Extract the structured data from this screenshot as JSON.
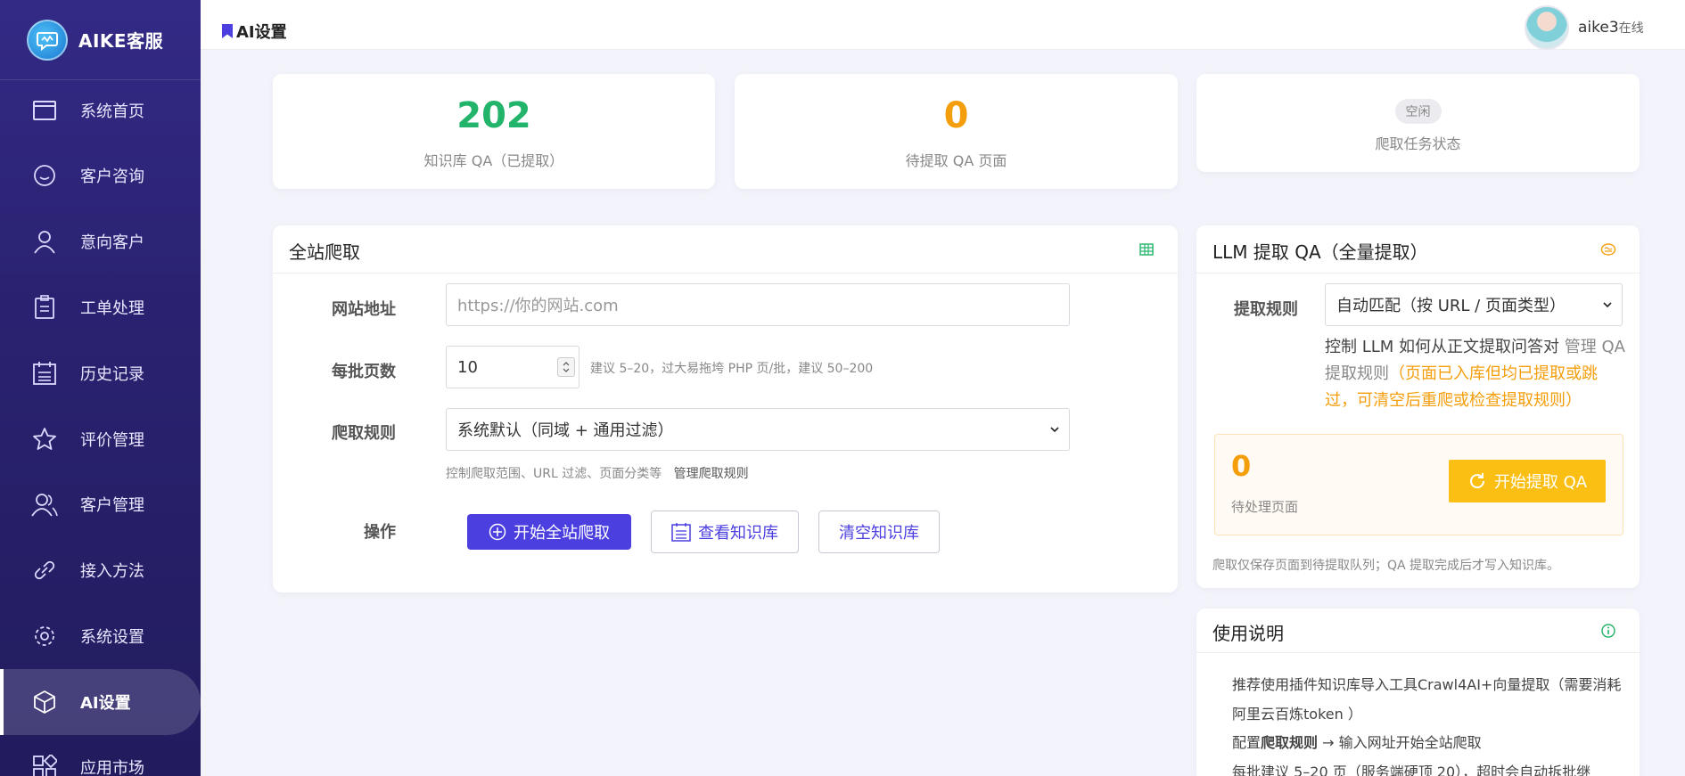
{
  "brand": {
    "name": "AIKE客服"
  },
  "sidebar": {
    "items": [
      {
        "label": "系统首页",
        "icon": "window-icon"
      },
      {
        "label": "客户咨询",
        "icon": "chat-icon"
      },
      {
        "label": "意向客户",
        "icon": "user-icon"
      },
      {
        "label": "工单处理",
        "icon": "clipboard-icon"
      },
      {
        "label": "历史记录",
        "icon": "calendar-list-icon"
      },
      {
        "label": "评价管理",
        "icon": "star-icon"
      },
      {
        "label": "客户管理",
        "icon": "users-icon"
      },
      {
        "label": "接入方法",
        "icon": "link-icon"
      },
      {
        "label": "系统设置",
        "icon": "gear-icon"
      },
      {
        "label": "AI设置",
        "icon": "cube-icon",
        "active": true
      },
      {
        "label": "应用市场",
        "icon": "apps-icon"
      }
    ]
  },
  "header": {
    "title": "AI设置",
    "user_name": "aike3",
    "user_status": "在线"
  },
  "stats": {
    "kb_qa": {
      "value": "202",
      "label": "知识库 QA（已提取）",
      "color": "#22b46a"
    },
    "pending_qa": {
      "value": "0",
      "label": "待提取 QA 页面",
      "color": "#f59e0b"
    },
    "crawl_status": {
      "badge": "空闲",
      "label": "爬取任务状态"
    }
  },
  "crawl": {
    "title": "全站爬取",
    "url_label": "网站地址",
    "url_placeholder": "https://你的网站.com",
    "batch_label": "每批页数",
    "batch_value": "10",
    "batch_hint": "建议 5–20，过大易拖垮 PHP   页/批，建议 50–200",
    "rule_label": "爬取规则",
    "rule_value": "系统默认（同域 + 通用过滤）",
    "rule_hint": "控制爬取范围、URL 过滤、页面分类等",
    "rule_link": "管理爬取规则",
    "action_label": "操作",
    "start_button": "开始全站爬取",
    "view_button": "查看知识库",
    "clear_button": "清空知识库"
  },
  "llm": {
    "title": "LLM 提取 QA（全量提取）",
    "rule_label": "提取规则",
    "rule_value": "自动匹配（按 URL / 页面类型）",
    "desc_prefix": "控制 LLM 如何从正文提取问答对",
    "desc_link": "管理 QA 提取规则",
    "desc_warning": "（页面已入库但均已提取或跳过，可清空后重爬或检查提取规则）",
    "pending_value": "0",
    "pending_label": "待处理页面",
    "start_button": "开始提取 QA",
    "footer_note": "爬取仅保存页面到待提取队列；QA 提取完成后才写入知识库。"
  },
  "guide": {
    "title": "使用说明",
    "line1": "推荐使用插件知识库导入工具Crawl4AI+向量提取（需要消耗",
    "line2": "阿里云百炼token ）",
    "line3_prefix": "配置",
    "line3_bold": "爬取规则",
    "line3_suffix": " → 输入网址开始全站爬取",
    "line4": "每批建议 5–20 页（服务端硬顶 20），超时会自动拆批继"
  },
  "colors": {
    "accent": "#4b3fe0",
    "success": "#22b46a",
    "warning": "#f59e0b",
    "amber_button": "#fbbf14",
    "sidebar": "#2a2270"
  }
}
